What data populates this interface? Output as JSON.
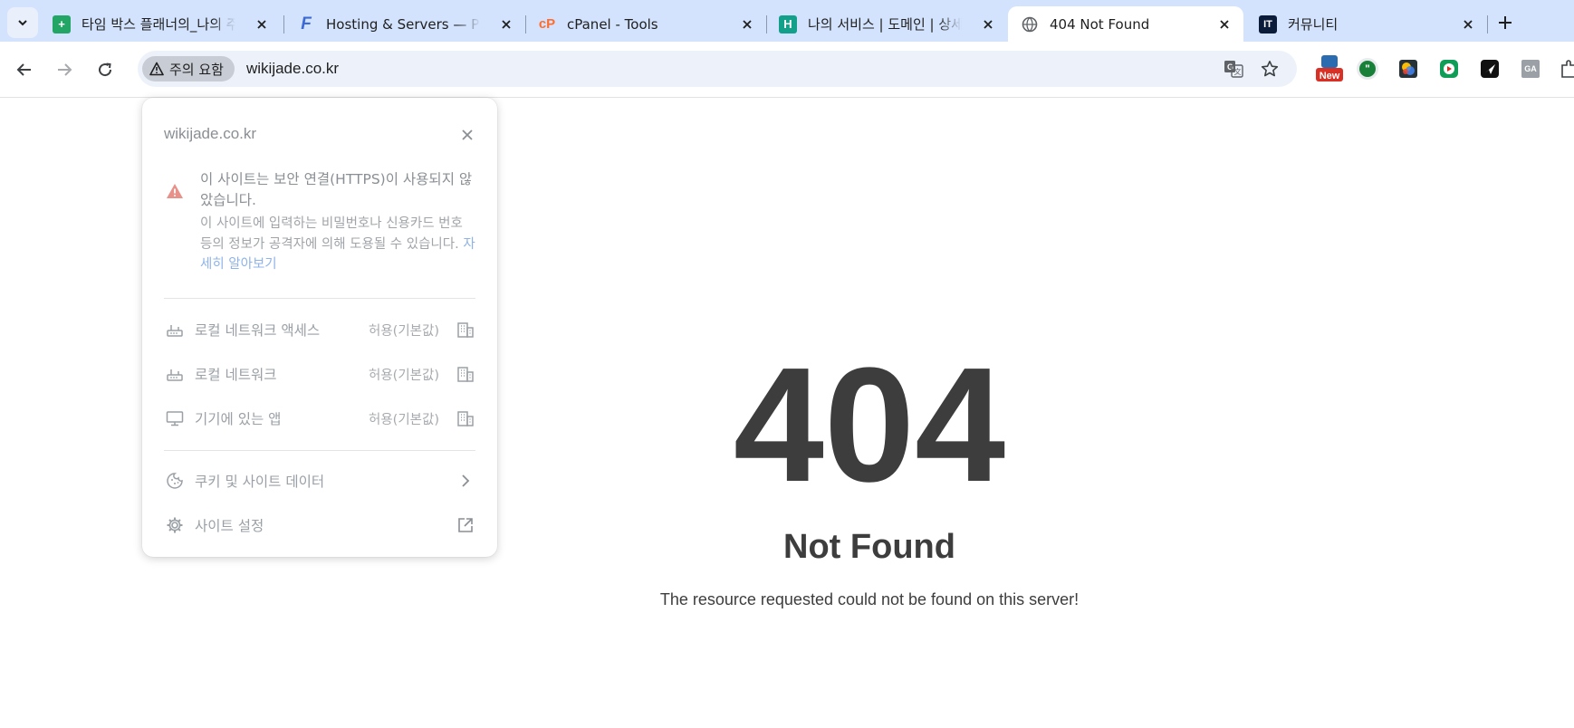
{
  "browser": {
    "tabs": [
      {
        "title": "타임 박스 플래너의_나의 주간",
        "favicon": "sheets-icon",
        "color": "#23a566",
        "active": false
      },
      {
        "title": "Hosting & Servers — Product",
        "favicon": "f-icon",
        "color": "#3d6bd6",
        "active": false
      },
      {
        "title": "cPanel - Tools",
        "favicon": "cpanel-icon",
        "color": "#ff6c2c",
        "active": false
      },
      {
        "title": "나의 서비스 | 도메인 | 상세",
        "favicon": "h-icon",
        "color": "#13a08a",
        "active": false
      },
      {
        "title": "404 Not Found",
        "favicon": "globe-icon",
        "color": "#5f6368",
        "active": true
      },
      {
        "title": "커뮤니티",
        "favicon": "it-icon",
        "color": "#0b1b3a",
        "active": false
      }
    ],
    "new_tab_label": "+",
    "security_chip": "주의 요함",
    "url": "wikijade.co.kr",
    "extensions": {
      "new_badge": "New"
    }
  },
  "site_info_popup": {
    "host": "wikijade.co.kr",
    "warning_title": "이 사이트는 보안 연결(HTTPS)이 사용되지 않았습니다.",
    "warning_body": "이 사이트에 입력하는 비밀번호나 신용카드 번호 등의 정보가 공격자에 의해 도용될 수 있습니다. ",
    "learn_more": "자세히 알아보기",
    "permissions": [
      {
        "label": "로컬 네트워크 액세스",
        "value": "허용(기본값)"
      },
      {
        "label": "로컬 네트워크",
        "value": "허용(기본값)"
      },
      {
        "label": "기기에 있는 앱",
        "value": "허용(기본값)"
      }
    ],
    "cookies_label": "쿠키 및 사이트 데이터",
    "site_settings_label": "사이트 설정"
  },
  "page": {
    "code": "404",
    "title": "Not Found",
    "message": "The resource requested could not be found on this server!"
  }
}
